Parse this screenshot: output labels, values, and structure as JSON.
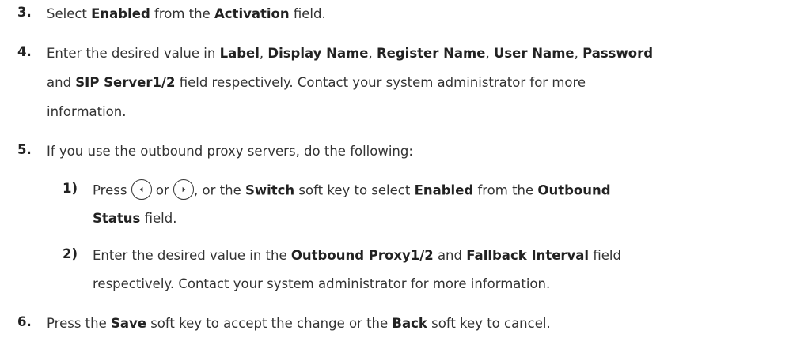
{
  "steps": [
    {
      "number": "3.",
      "t1": "Select ",
      "b1": "Enabled",
      "t2": " from the ",
      "b2": "Activation",
      "t3": " field."
    },
    {
      "number": "4.",
      "t1": "Enter the desired value in ",
      "b1": "Label",
      "t2": ", ",
      "b2": "Display Name",
      "t3": ", ",
      "b3": "Register Name",
      "t4": ", ",
      "b4": "User Name",
      "t5": ", ",
      "b5": "Password",
      "t6": "and ",
      "b6": "SIP Server1/2",
      "t7": " field respectively. Contact your system administrator for more",
      "t8": "information."
    },
    {
      "number": "5.",
      "t1": "If you use the outbound proxy servers, do the following:"
    },
    {
      "number": "6.",
      "t1": "Press the ",
      "b1": "Save",
      "t2": " soft key to accept the change or the ",
      "b2": "Back",
      "t3": " soft key to cancel."
    }
  ],
  "substeps": [
    {
      "number": "1)",
      "t1": "Press ",
      "icon1": "left-navigation-key-icon",
      "t2": " or ",
      "icon2": "right-navigation-key-icon",
      "t3": ", or the ",
      "b1": "Switch",
      "t4": " soft key to select ",
      "b2": "Enabled",
      "t5": " from the ",
      "b3": "Outbound",
      "b4": "Status",
      "t6": " field."
    },
    {
      "number": "2)",
      "t1": "Enter the desired value in the ",
      "b1": "Outbound Proxy1/2",
      "t2": " and ",
      "b2": "Fallback Interval",
      "t3": " field",
      "t4": "respectively. Contact your system administrator for more information."
    }
  ]
}
